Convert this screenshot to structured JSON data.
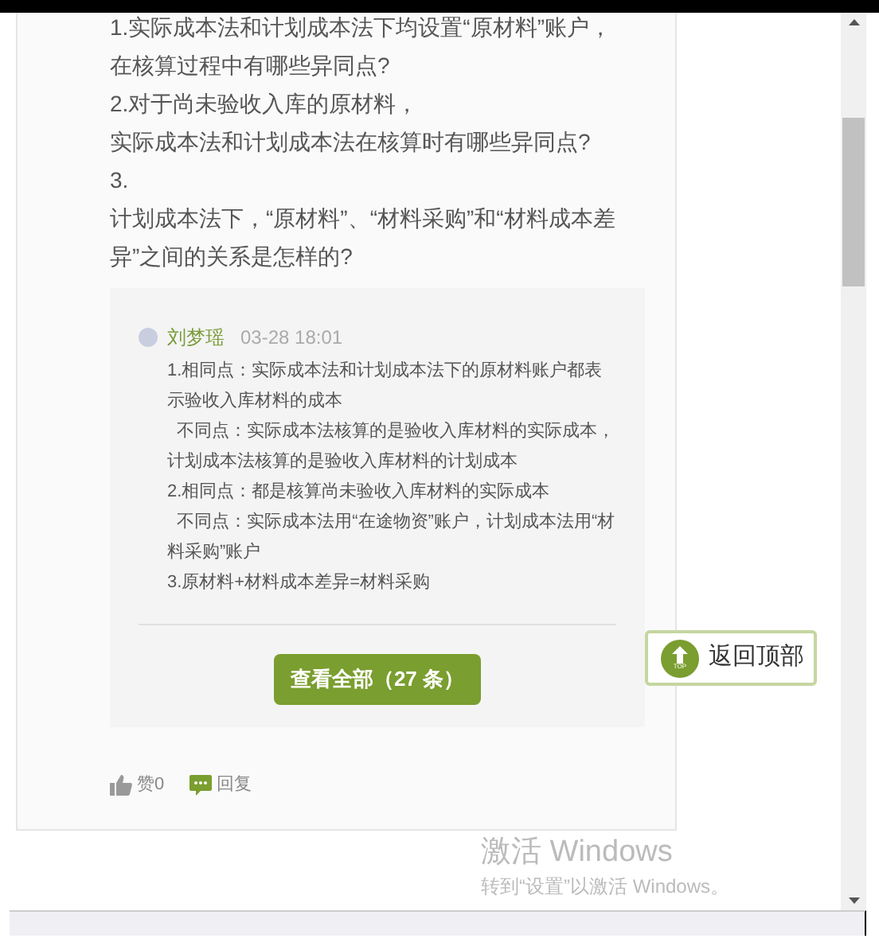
{
  "question": {
    "lines": [
      "1.实际成本法和计划成本法下均设置“原材料”账户，",
      "在核算过程中有哪些异同点?",
      "2.对于尚未验收入库的原材料，",
      "实际成本法和计划成本法在核算时有哪些异同点?",
      "3.",
      "计划成本法下，“原材料”、“材料采购”和“材料成本差异”之间的关系是怎样的?"
    ]
  },
  "reply": {
    "author": "刘梦瑶",
    "time": "03-28 18:01",
    "lines": [
      "1.相同点：实际成本法和计划成本法下的原材料账户都表示验收入库材料的成本",
      "  不同点：实际成本法核算的是验收入库材料的实际成本，计划成本法核算的是验收入库材料的计划成本",
      "2.相同点：都是核算尚未验收入库材料的实际成本",
      "  不同点：实际成本法用“在途物资”账户，计划成本法用“材料采购”账户",
      "3.原材料+材料成本差异=材料采购"
    ]
  },
  "view_all_button": "查看全部（27 条）",
  "back_to_top": {
    "label": "返回顶部",
    "icon_text": "TOP"
  },
  "actions": [
    {
      "kind": "like",
      "label": "赞0"
    },
    {
      "kind": "reply",
      "label": "回复"
    }
  ],
  "activation_notice": {
    "title": "激活 Windows",
    "subtitle": "转到“设置”以激活 Windows。"
  }
}
